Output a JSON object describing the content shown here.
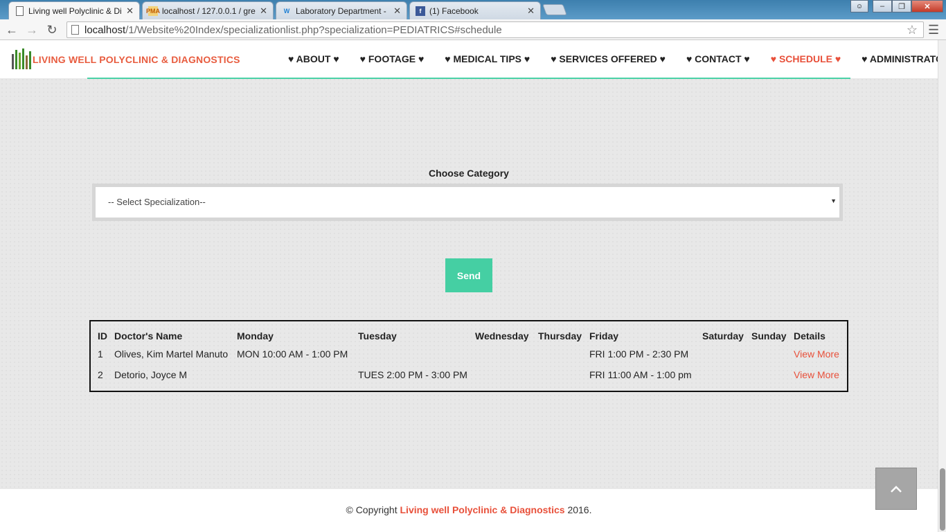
{
  "browser": {
    "tabs": [
      {
        "title": "Living well Polyclinic & Di",
        "icon": "page-icon",
        "active": true
      },
      {
        "title": "localhost / 127.0.0.1 / gre",
        "icon": "phpmyadmin-icon",
        "active": false
      },
      {
        "title": "Laboratory Department - ",
        "icon": "weebly-icon",
        "active": false
      },
      {
        "title": "(1) Facebook",
        "icon": "facebook-icon",
        "active": false
      }
    ],
    "url_host": "localhost",
    "url_path": "/1/Website%20Index/specializationlist.php?specialization=PEDIATRICS#schedule",
    "favicon_text_pma": "PMA",
    "favicon_text_w": "W",
    "favicon_text_f": "f"
  },
  "header": {
    "brand": "LIVING WELL POLYCLINIC & DIAGNOSTICS",
    "nav": [
      {
        "label": "♥ ABOUT ♥",
        "active": false
      },
      {
        "label": "♥ FOOTAGE ♥",
        "active": false
      },
      {
        "label": "♥ MEDICAL TIPS ♥",
        "active": false
      },
      {
        "label": "♥ SERVICES OFFERED ♥",
        "active": false
      },
      {
        "label": "♥ CONTACT ♥",
        "active": false
      },
      {
        "label": "♥ SCHEDULE ♥",
        "active": true
      },
      {
        "label": "♥ ADMINISTRATOR ♥",
        "active": false
      }
    ]
  },
  "form": {
    "label": "Choose Category",
    "select_value": "-- Select Specialization--",
    "send_label": "Send"
  },
  "schedule": {
    "headers": [
      "ID",
      "Doctor's Name",
      "Monday",
      "Tuesday",
      "Wednesday",
      "Thursday",
      "Friday",
      "Saturday",
      "Sunday",
      "Details"
    ],
    "rows": [
      [
        "1",
        "Olives, Kim Martel Manuto",
        "MON 10:00 AM - 1:00 PM",
        "",
        "",
        "",
        "FRI 1:00 PM - 2:30 PM",
        "",
        "",
        "View More"
      ],
      [
        "2",
        "Detorio, Joyce M",
        "",
        "TUES 2:00 PM - 3:00 PM",
        "",
        "",
        "FRI 11:00 AM - 1:00 pm",
        "",
        "",
        "View More"
      ]
    ]
  },
  "footer": {
    "prefix": "© Copyright ",
    "brand": "Living well Polyclinic & Diagnostics",
    "suffix": " 2016."
  },
  "colors": {
    "accent_red": "#e8503a",
    "accent_green": "#45cfa3"
  }
}
